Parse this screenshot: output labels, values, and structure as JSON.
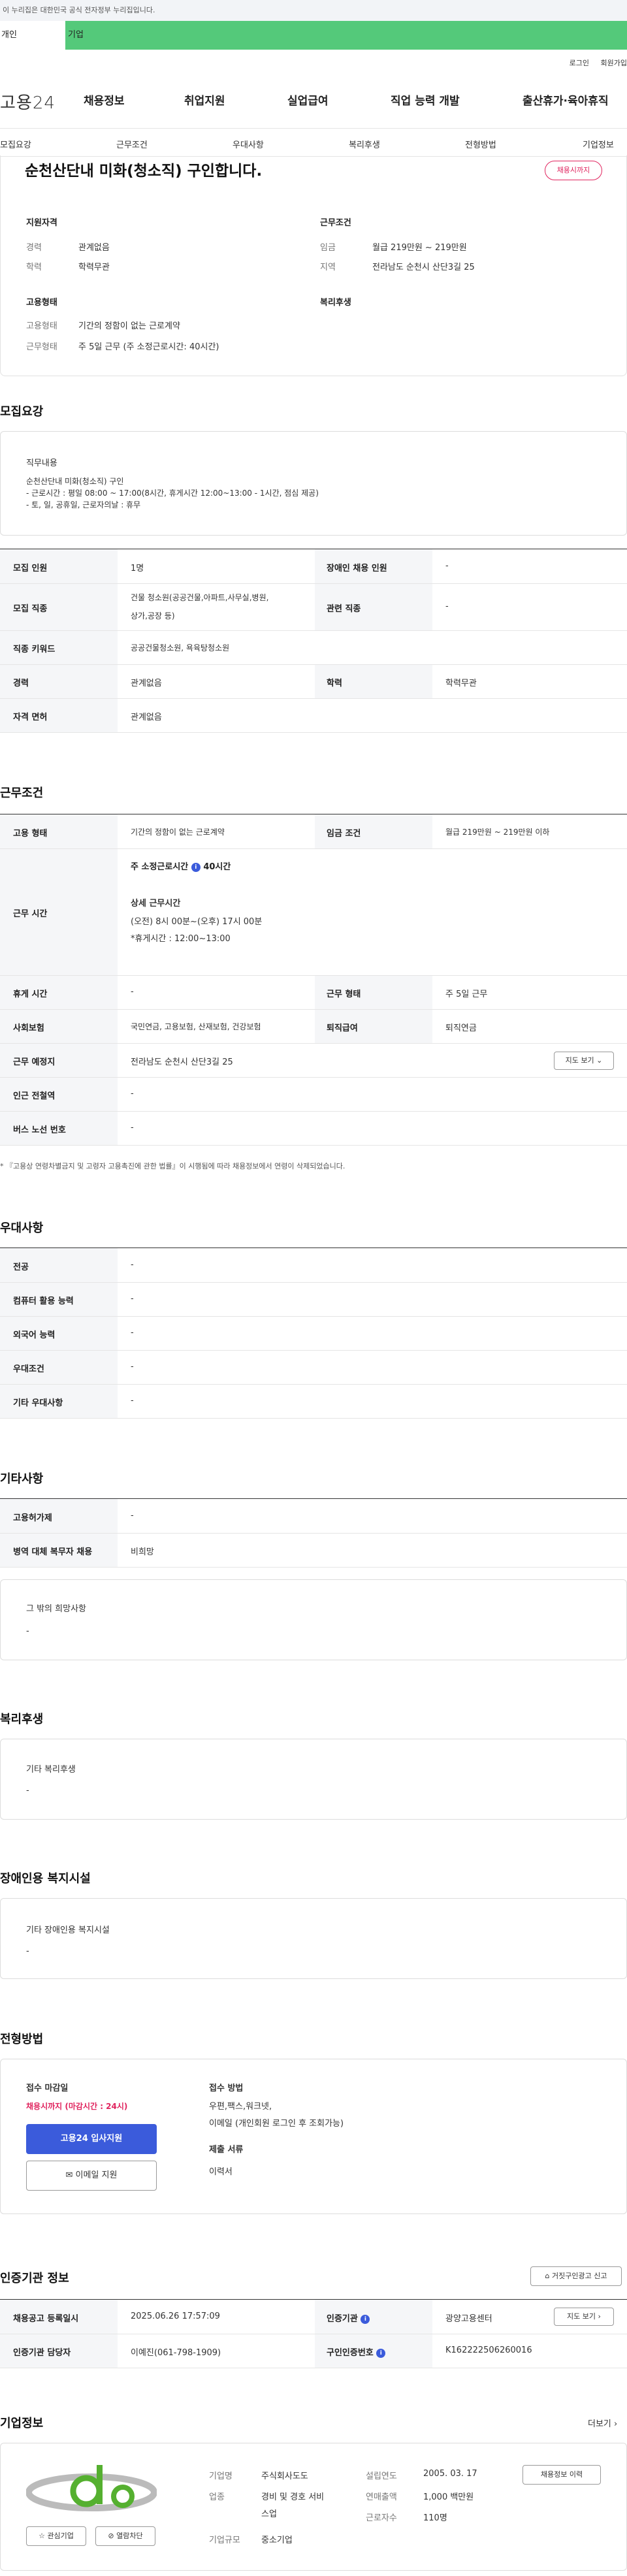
{
  "gov_banner": "이 누리집은 대한민국 공식 전자정부 누리집입니다.",
  "site_tabs": [
    "개인",
    "기업"
  ],
  "util": {
    "login": "로그인",
    "join": "회원가입"
  },
  "logo": "고용24",
  "gnb": [
    "채용정보",
    "취업지원",
    "실업급여",
    "직업 능력 개발",
    "출산휴가·육아휴직"
  ],
  "lnb": [
    "모집요강",
    "근무조건",
    "우대사항",
    "복리후생",
    "전형방법",
    "기업정보"
  ],
  "job": {
    "title": "순천산단내 미화(청소직) 구인합니다.",
    "badge": "채용시까지",
    "qual_title": "지원자격",
    "qual": [
      {
        "k": "경력",
        "v": "관계없음"
      },
      {
        "k": "학력",
        "v": "학력무관"
      }
    ],
    "cond_title": "근무조건",
    "cond": [
      {
        "k": "임금",
        "v": "월급 219만원 ~ 219만원"
      },
      {
        "k": "지역",
        "v": "전라남도 순천시 산단3길 25"
      }
    ],
    "emp_title": "고용형태",
    "emp": [
      {
        "k": "고용형태",
        "v": "기간의 정함이 없는 근로계약"
      },
      {
        "k": "근무형태",
        "v": "주 5일 근무 (주 소정근로시간: 40시간)"
      }
    ],
    "welfare_title": "복리후생"
  },
  "recruit": {
    "title": "모집요강",
    "duty_label": "직무내용",
    "duty_lines": [
      "순천산단내 미화(청소직) 구인",
      "- 근로시간 : 평일 08:00 ~ 17:00(8시간, 휴게시간 12:00~13:00 - 1시간, 점심 제공)",
      "- 토, 일, 공휴일, 근로자의날 : 휴무"
    ],
    "rows": [
      {
        "k1": "모집 인원",
        "v1": "1명",
        "k2": "장애인 채용 인원",
        "v2": "-"
      },
      {
        "k1": "모집 직종",
        "v1a": "건물 청소원(공공건물,아파트,사무실,병원,",
        "v1b": "상가,공장 등)",
        "k2": "관련 직종",
        "v2": "-"
      },
      {
        "k1": "직종 키워드",
        "v1": "공공건물청소원, 욕육탕청소원"
      },
      {
        "k1": "경력",
        "v1": "관계없음",
        "k2": "학력",
        "v2": "학력무관"
      },
      {
        "k1": "자격 면허",
        "v1": "관계없음"
      }
    ]
  },
  "work": {
    "title": "근무조건",
    "r1": {
      "k1": "고용 형태",
      "v1": "기간의 정함이 없는 근로계약",
      "k2": "임금 조건",
      "v2": "월급 219만원 ~ 219만원 이하"
    },
    "r2": {
      "k": "근무 시간",
      "weekly": "주 소정근로시간",
      "weekly_v": "40시간",
      "detail": "상세 근무시간",
      "line1": "(오전) 8시 00분~(오후) 17시 00분",
      "line2": "*휴게시간 : 12:00~13:00"
    },
    "r3": {
      "k1": "휴게 시간",
      "v1": "-",
      "k2": "근무 형태",
      "v2": "주 5일 근무"
    },
    "r4": {
      "k1": "사회보험",
      "v1": "국민연금, 고용보험, 산재보험, 건강보험",
      "k2": "퇴직급여",
      "v2": "퇴직연금"
    },
    "r5": {
      "k": "근무 예정지",
      "v": "전라남도 순천시 산단3길 25",
      "btn": "지도 보기"
    },
    "r6": {
      "k": "인근 전철역",
      "v": "-"
    },
    "r7": {
      "k": "버스 노선 번호",
      "v": "-"
    },
    "note": "* 『고용상 연령차별금지 및 고령자 고용촉진에 관한 법률』이 시행됨에 따라 채용정보에서 연령이 삭제되었습니다."
  },
  "pref": {
    "title": "우대사항",
    "rows": [
      {
        "k": "전공",
        "v": "-"
      },
      {
        "k": "컴퓨터 활용 능력",
        "v": "-"
      },
      {
        "k": "외국어 능력",
        "v": "-"
      },
      {
        "k": "우대조건",
        "v": "-"
      },
      {
        "k": "기타 우대사항",
        "v": "-"
      }
    ]
  },
  "etc": {
    "title": "기타사항",
    "rows": [
      {
        "k": "고용허가제",
        "v": "-"
      },
      {
        "k": "병역 대체 복무자 채용",
        "v": "비희망"
      }
    ],
    "box_label": "그 밖의 희망사항",
    "box_value": "-"
  },
  "welfare": {
    "title": "복리후생",
    "label": "기타 복리후생",
    "value": "-"
  },
  "disabled": {
    "title": "장애인용 복지시설",
    "label": "기타 장애인용 복지시설",
    "value": "-"
  },
  "selection": {
    "title": "전형방법",
    "deadline_label": "접수 마감일",
    "deadline_value": "채용시까지 (마감시간 : 24시)",
    "apply_btn": "고용24 입사지원",
    "email_btn": "이메일 지원",
    "method_label": "접수 방법",
    "method_line1": "우편,팩스,워크넷,",
    "method_line2": "이메일 (개인회원 로그인 후 조회가능)",
    "doc_label": "제출 서류",
    "doc_value": "이력서"
  },
  "agency": {
    "title": "인증기관 정보",
    "report_btn": "거짓구인광고 신고",
    "reg_k": "채용공고 등록일시",
    "reg_v": "2025.06.26 17:57:09",
    "agency_k": "인증기관",
    "agency_v": "광양고용센터",
    "map_btn": "지도 보기",
    "staff_k": "인증기관 담당자",
    "staff_v": "이예진(061-798-1909)",
    "auth_k": "구인인증번호",
    "auth_v": "K162222506260016"
  },
  "company": {
    "title": "기업정보",
    "more": "더보기",
    "name_k": "기업명",
    "name_v": "주식회사도도",
    "type_k": "업종",
    "type_v1": "경비 및 경호 서비",
    "type_v2": "스업",
    "size_k": "기업규모",
    "size_v": "중소기업",
    "year_k": "설립연도",
    "year_v": "2005. 03. 17",
    "sales_k": "연매출액",
    "sales_v": "1,000 백만원",
    "emp_k": "근로자수",
    "emp_v": "110명",
    "history_btn": "채용정보 이력",
    "fav_btn": "관심기업",
    "block_btn": "열람차단",
    "colors": {
      "accent": "#3b5bdb",
      "brand_green": "#54c97a",
      "alert": "#e0245e"
    }
  }
}
